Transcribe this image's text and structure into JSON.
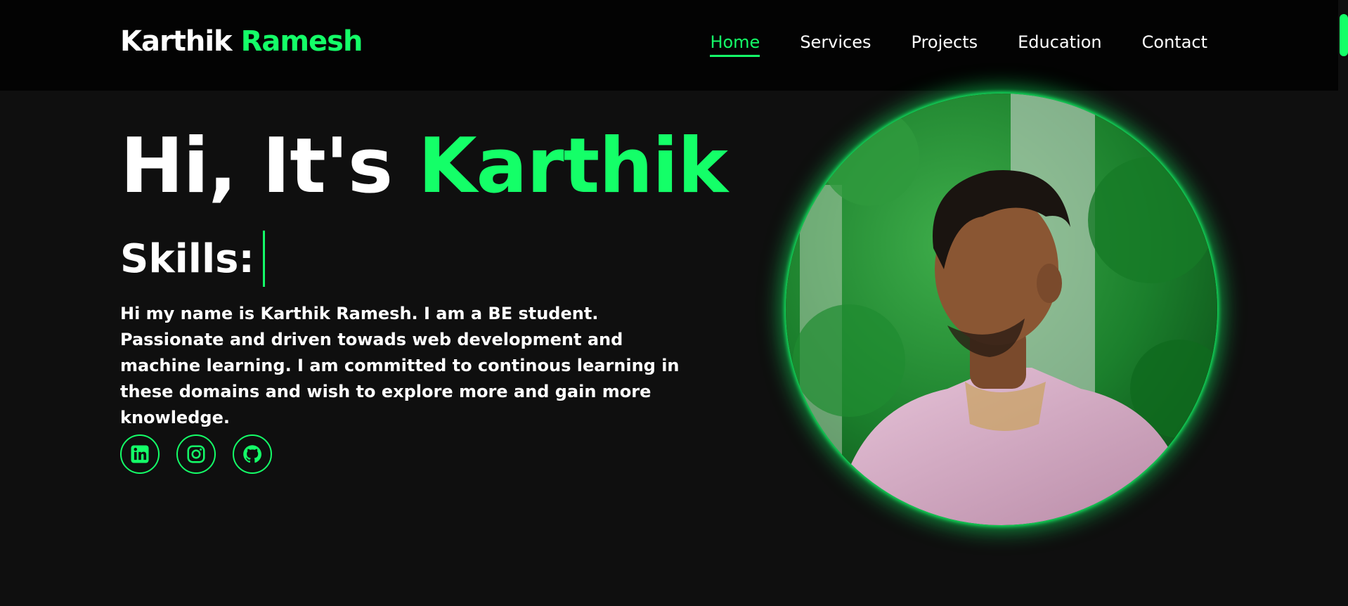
{
  "header": {
    "logo_first": "Karthik",
    "logo_last": "Ramesh",
    "nav": [
      {
        "label": "Home",
        "active": true
      },
      {
        "label": "Services",
        "active": false
      },
      {
        "label": "Projects",
        "active": false
      },
      {
        "label": "Education",
        "active": false
      },
      {
        "label": "Contact",
        "active": false
      }
    ]
  },
  "hero": {
    "greeting": "Hi, It's",
    "name": "Karthik",
    "skills_label": "Skills:",
    "bio": "Hi my name is Karthik Ramesh. I am a BE student. Passionate and driven towads web development and machine learning. I am committed to continous learning in these domains and wish to explore more and gain more knowledge."
  },
  "socials": [
    {
      "icon": "linkedin-icon"
    },
    {
      "icon": "instagram-icon"
    },
    {
      "icon": "github-icon"
    }
  ],
  "colors": {
    "accent": "#14ff68",
    "background": "#0f0f0f",
    "header_background": "#030303",
    "text": "#ffffff"
  }
}
